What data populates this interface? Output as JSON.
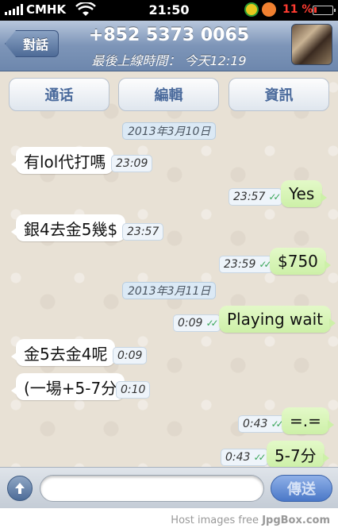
{
  "status_bar": {
    "carrier": "CMHK",
    "time": "21:50",
    "battery_percent": "11 %"
  },
  "nav": {
    "back_label": "對話",
    "title": "+852 5373 0065",
    "subtitle": "最後上線時間： 今天12:19"
  },
  "actions": {
    "call": "通话",
    "edit": "編輯",
    "info": "資訊"
  },
  "messages": {
    "date1": "2013年3月10日",
    "m1_text": "有lol代打嗎",
    "m1_time": "23:09",
    "m2_text": "Yes",
    "m2_time": "23:57",
    "m3_text": "銀4去金5幾$",
    "m3_time": "23:57",
    "m4_text": "$750",
    "m4_time": "23:59",
    "date2": "2013年3月11日",
    "m5_text": "Playing wait",
    "m5_time": "0:09",
    "m6_text": "金5去金4呢",
    "m6_time": "0:09",
    "m7_text": "(一場+5-7分",
    "m7_time": "0:10",
    "m8_text": "=.=",
    "m8_time": "0:43",
    "m9_text": "5-7分",
    "m9_time": "0:43"
  },
  "input": {
    "placeholder": "",
    "send_label": "傳送"
  },
  "footer": {
    "prefix": "Host images free",
    "brand": "JpgBox.com"
  },
  "colors": {
    "nav_gradient": "#7d95b8",
    "outgoing_bubble": "#cdf0a8",
    "chat_background": "#e8e1d5",
    "battery_low": "#ff3b30"
  }
}
